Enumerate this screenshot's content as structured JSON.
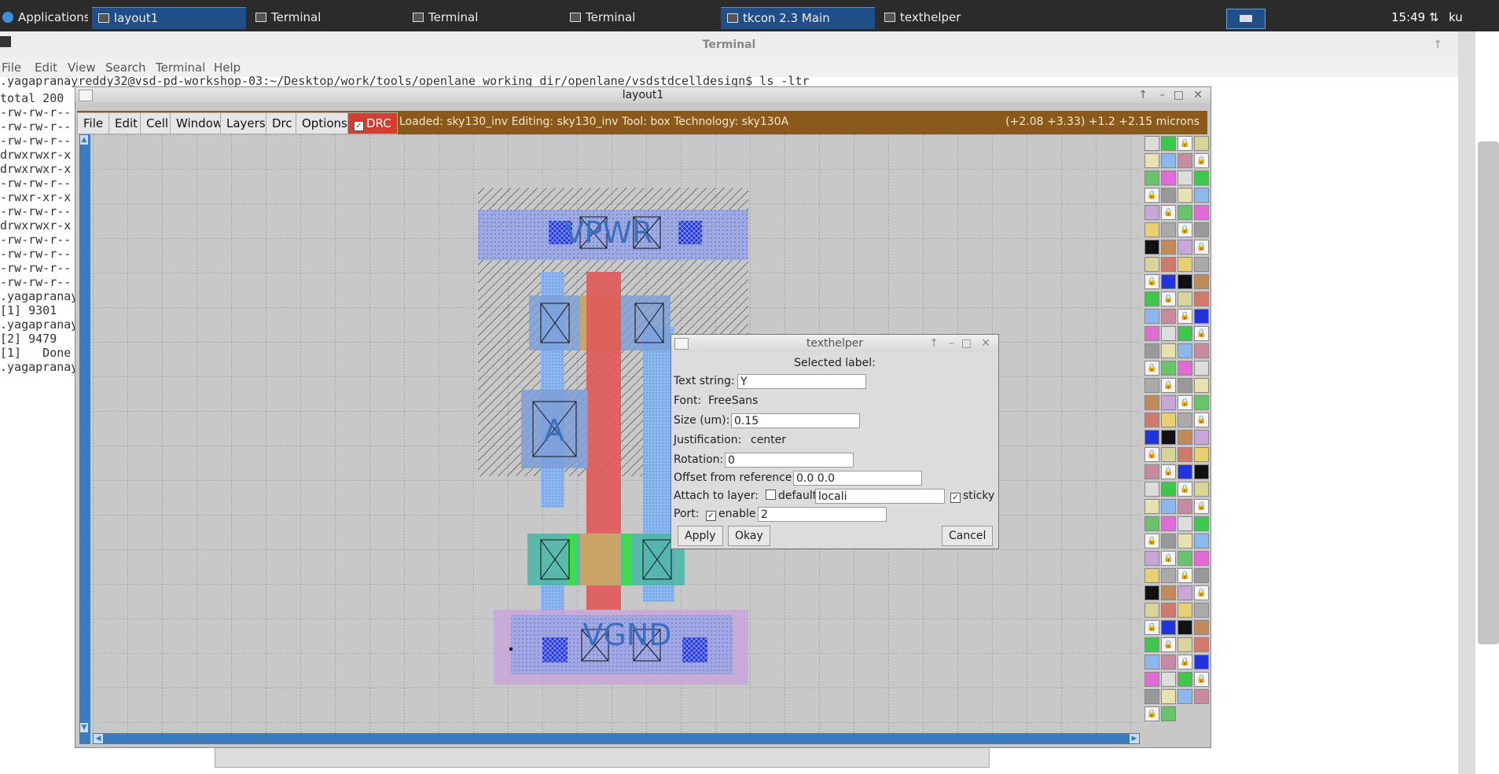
{
  "taskbar": {
    "apps_label": "Applications",
    "items": [
      "layout1",
      "Terminal",
      "Terminal",
      "Terminal",
      "tkcon 2.3 Main",
      "texthelper"
    ],
    "clock": "15:49",
    "user": "ku"
  },
  "terminal": {
    "title": "Terminal",
    "menu": [
      "File",
      "Edit",
      "View",
      "Search",
      "Terminal",
      "Help"
    ],
    "prompt_line": ".yagapranayreddy32@vsd-pd-workshop-03:~/Desktop/work/tools/openlane_working_dir/openlane/vsdstdcelldesign$ ls -ltr",
    "lines": [
      "total 200",
      "-rw-rw-r--",
      "-rw-rw-r--",
      "-rw-rw-r--",
      "drwxrwxr-x",
      "drwxrwxr-x",
      "-rw-rw-r--",
      "-rwxr-xr-x",
      "-rw-rw-r--",
      "drwxrwxr-x",
      "-rw-rw-r--",
      "-rw-rw-r--",
      "-rw-rw-r--",
      "-rw-rw-r--",
      ".yagapranay",
      "[1] 9301",
      ".yagapranay",
      "[2] 9479",
      "[1]   Done",
      ".yagapranay"
    ]
  },
  "layout": {
    "title": "layout1",
    "menu": [
      "File",
      "Edit",
      "Cell",
      "Window",
      "Layers",
      "Drc",
      "Options"
    ],
    "drc_label": "DRC",
    "status": "Loaded: sky130_inv  Editing: sky130_inv  Tool: box   Technology: sky130A",
    "coords": "(+2.08 +3.33) +1.2 +2.15 microns",
    "labels": {
      "vpwr": "VPWR",
      "vgnd": "VGND",
      "a": "A"
    }
  },
  "texthelper": {
    "title": "texthelper",
    "heading": "Selected label:",
    "text_string_label": "Text string:",
    "text_string_value": "Y",
    "font_label": "Font:",
    "font_value": "FreeSans",
    "size_label": "Size (um):",
    "size_value": "0.15",
    "justification_label": "Justification:",
    "justification_value": "center",
    "rotation_label": "Rotation:",
    "rotation_value": "0",
    "offset_label": "Offset from reference:",
    "offset_value": "0.0 0.0",
    "attach_label": "Attach to layer:",
    "default_label": "default",
    "layer_value": "locali",
    "sticky_label": "sticky",
    "port_label": "Port:",
    "enable_label": "enable",
    "port_value": "2",
    "apply_label": "Apply",
    "okay_label": "Okay",
    "cancel_label": "Cancel"
  }
}
